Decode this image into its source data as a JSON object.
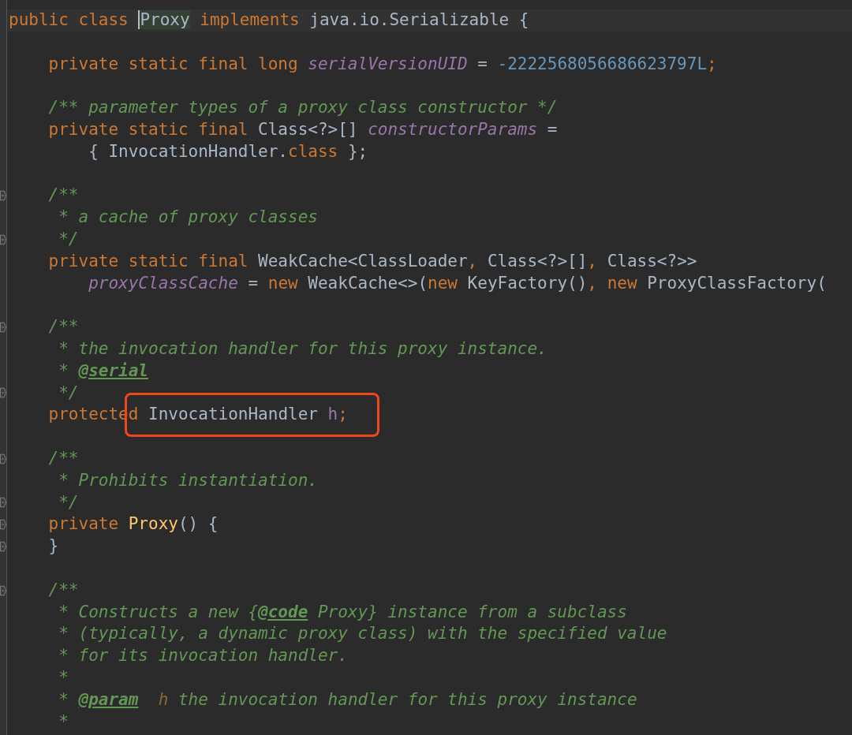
{
  "editor": {
    "lines": [
      {
        "fold": false,
        "current": true,
        "tokens": [
          {
            "kind": "keyword",
            "text": "public class "
          },
          {
            "kind": "plain",
            "text": "Proxy",
            "usage": true,
            "caret_before": true
          },
          {
            "kind": "keyword",
            "text": " implements "
          },
          {
            "kind": "plain",
            "text": "java.io.Serializable {"
          }
        ]
      },
      {
        "fold": false
      },
      {
        "fold": false,
        "tokens": [
          {
            "kind": "keyword",
            "text": "    private static final long "
          },
          {
            "kind": "static-field",
            "text": "serialVersionUID"
          },
          {
            "kind": "plain",
            "text": " = "
          },
          {
            "kind": "number",
            "text": "-2222568056686623797L"
          },
          {
            "kind": "punct",
            "text": ";"
          }
        ]
      },
      {
        "fold": false
      },
      {
        "fold": false,
        "tokens": [
          {
            "kind": "comment",
            "text": "    /** parameter types of a proxy class constructor */"
          }
        ]
      },
      {
        "fold": false,
        "tokens": [
          {
            "kind": "keyword",
            "text": "    private static final "
          },
          {
            "kind": "plain",
            "text": "Class<?>[] "
          },
          {
            "kind": "static-field",
            "text": "constructorParams"
          },
          {
            "kind": "plain",
            "text": " ="
          }
        ]
      },
      {
        "fold": false,
        "tokens": [
          {
            "kind": "plain",
            "text": "        { InvocationHandler."
          },
          {
            "kind": "keyword",
            "text": "class"
          },
          {
            "kind": "plain",
            "text": " };"
          }
        ]
      },
      {
        "fold": false
      },
      {
        "fold": true,
        "tokens": [
          {
            "kind": "comment",
            "text": "    /**"
          }
        ]
      },
      {
        "fold": false,
        "tokens": [
          {
            "kind": "comment",
            "text": "     * a cache of proxy classes"
          }
        ]
      },
      {
        "fold": true,
        "tokens": [
          {
            "kind": "comment",
            "text": "     */"
          }
        ]
      },
      {
        "fold": false,
        "tokens": [
          {
            "kind": "keyword",
            "text": "    private static final "
          },
          {
            "kind": "plain",
            "text": "WeakCache<ClassLoader"
          },
          {
            "kind": "punct",
            "text": ", "
          },
          {
            "kind": "plain",
            "text": "Class<?>[]"
          },
          {
            "kind": "punct",
            "text": ", "
          },
          {
            "kind": "plain",
            "text": "Class<?>>"
          }
        ]
      },
      {
        "fold": false,
        "tokens": [
          {
            "kind": "static-field",
            "text": "        proxyClassCache"
          },
          {
            "kind": "plain",
            "text": " = "
          },
          {
            "kind": "keyword",
            "text": "new "
          },
          {
            "kind": "plain",
            "text": "WeakCache<>("
          },
          {
            "kind": "keyword",
            "text": "new "
          },
          {
            "kind": "plain",
            "text": "KeyFactory()"
          },
          {
            "kind": "punct",
            "text": ", "
          },
          {
            "kind": "keyword",
            "text": "new "
          },
          {
            "kind": "plain",
            "text": "ProxyClassFactory("
          }
        ]
      },
      {
        "fold": false
      },
      {
        "fold": true,
        "tokens": [
          {
            "kind": "comment",
            "text": "    /**"
          }
        ]
      },
      {
        "fold": false,
        "tokens": [
          {
            "kind": "comment",
            "text": "     * the invocation handler for this proxy instance."
          }
        ]
      },
      {
        "fold": false,
        "tokens": [
          {
            "kind": "comment",
            "text": "     * "
          },
          {
            "kind": "doc-tag",
            "text": "@serial"
          }
        ]
      },
      {
        "fold": true,
        "tokens": [
          {
            "kind": "comment",
            "text": "     */"
          }
        ]
      },
      {
        "fold": false,
        "tokens": [
          {
            "kind": "keyword",
            "text": "    protecte"
          },
          {
            "kind": "keyword",
            "text": "d",
            "highlighted": true
          },
          {
            "kind": "plain",
            "text": " InvocationHandler ",
            "highlighted": true
          },
          {
            "kind": "field",
            "text": "h",
            "highlighted": true
          },
          {
            "kind": "punct",
            "text": ";",
            "highlighted": true
          }
        ]
      },
      {
        "fold": false
      },
      {
        "fold": true,
        "tokens": [
          {
            "kind": "comment",
            "text": "    /**"
          }
        ]
      },
      {
        "fold": false,
        "tokens": [
          {
            "kind": "comment",
            "text": "     * Prohibits instantiation."
          }
        ]
      },
      {
        "fold": true,
        "tokens": [
          {
            "kind": "comment",
            "text": "     */"
          }
        ]
      },
      {
        "fold": true,
        "tokens": [
          {
            "kind": "keyword",
            "text": "    private "
          },
          {
            "kind": "method",
            "text": "Proxy"
          },
          {
            "kind": "plain",
            "text": "() {"
          }
        ]
      },
      {
        "fold": true,
        "tokens": [
          {
            "kind": "plain",
            "text": "    }"
          }
        ]
      },
      {
        "fold": false
      },
      {
        "fold": true,
        "tokens": [
          {
            "kind": "comment",
            "text": "    /**"
          }
        ]
      },
      {
        "fold": false,
        "tokens": [
          {
            "kind": "comment",
            "text": "     * Constructs a new {"
          },
          {
            "kind": "doc-tag",
            "text": "@code"
          },
          {
            "kind": "comment",
            "text": " Proxy} instance from a subclass"
          }
        ]
      },
      {
        "fold": false,
        "tokens": [
          {
            "kind": "comment",
            "text": "     * (typically, a dynamic proxy class) with the specified value"
          }
        ]
      },
      {
        "fold": false,
        "tokens": [
          {
            "kind": "comment",
            "text": "     * for its invocation handler."
          }
        ]
      },
      {
        "fold": false,
        "tokens": [
          {
            "kind": "comment",
            "text": "     *"
          }
        ]
      },
      {
        "fold": false,
        "tokens": [
          {
            "kind": "comment",
            "text": "     * "
          },
          {
            "kind": "doc-tag",
            "text": "@param"
          },
          {
            "kind": "doc-param",
            "text": "  h"
          },
          {
            "kind": "comment",
            "text": " the invocation handler for this proxy instance"
          }
        ]
      },
      {
        "fold": false,
        "tokens": [
          {
            "kind": "comment",
            "text": "     *"
          }
        ]
      }
    ]
  }
}
